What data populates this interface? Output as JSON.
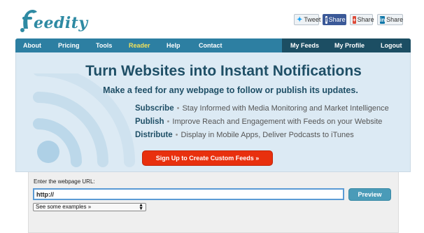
{
  "header": {
    "logo_text": "eedity",
    "share": {
      "tweet": "Tweet",
      "facebook": "Share",
      "google": "Share",
      "linkedin": "Share"
    }
  },
  "nav": {
    "left": [
      "About",
      "Pricing",
      "Tools",
      "Reader",
      "Help",
      "Contact"
    ],
    "right": [
      "My Feeds",
      "My Profile",
      "Logout"
    ]
  },
  "hero": {
    "title": "Turn Websites into Instant Notifications",
    "subtitle": "Make a feed for any webpage to follow or publish its updates.",
    "features": [
      {
        "term": "Subscribe",
        "desc": "Stay Informed with Media Monitoring and Market Intelligence"
      },
      {
        "term": "Publish",
        "desc": "Improve Reach and Engagement with Feeds on your Website"
      },
      {
        "term": "Distribute",
        "desc": "Display in Mobile Apps, Deliver Podcasts to iTunes"
      }
    ],
    "signup_label": "Sign Up to Create Custom Feeds »"
  },
  "form": {
    "label": "Enter the webpage URL:",
    "url_value": "http://",
    "preview_label": "Preview",
    "examples_label": "See some examples »"
  },
  "colors": {
    "nav": "#2d7fa2",
    "nav_dark": "#1c4e63",
    "hero_bg": "#dceaf4",
    "title": "#1f4f66",
    "signup": "#e8300e",
    "reader_highlight": "#f2e15a"
  }
}
